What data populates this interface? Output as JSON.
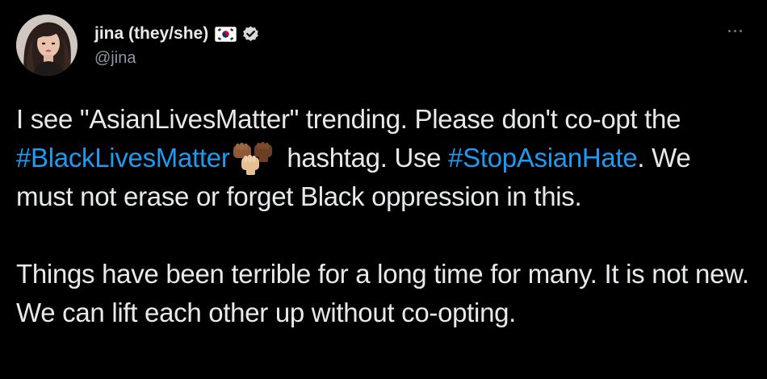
{
  "user": {
    "display_name": "jina (they/she)",
    "handle": "@jina",
    "flag_icon": "south-korea-flag-icon",
    "verified_icon": "verified-badge-icon"
  },
  "actions": {
    "more_icon": "more-horizontal-icon"
  },
  "tweet": {
    "p1_text1": "I see \"AsianLivesMatter\" trending. Please don't co-opt the ",
    "hashtag1": "#BlackLivesMatter",
    "emoji1_icon": "raised-fists-emoji-icon",
    "p1_text2": " hashtag. Use ",
    "hashtag2": "#StopAsianHate",
    "p1_text3": ". We must not erase or forget Black oppression in this.",
    "p2_text": "Things have been terrible for a long time for many. It is not new. We can lift each other up without co-opting."
  },
  "colors": {
    "background": "#000000",
    "text": "#e7e9ea",
    "secondary_text": "#8b98a5",
    "link": "#1d9bf0"
  }
}
